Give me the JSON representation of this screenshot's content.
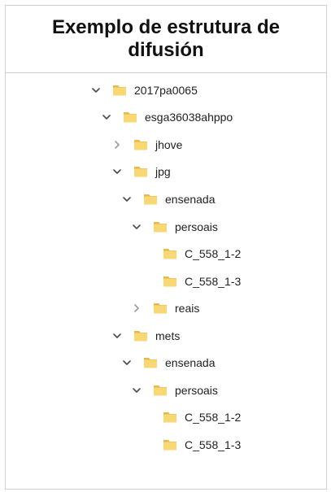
{
  "title": {
    "line1": "Exemplo de estrutura de",
    "line2": "difusión"
  },
  "colors": {
    "folder_fill": "#F8D775",
    "folder_back": "#E8B84A",
    "chevron": "#4a4a4a",
    "chevron_collapsed": "#9a9a9a",
    "border": "#cfcfcf"
  },
  "tree": [
    {
      "label": "2017pa0065",
      "expander": "expanded",
      "icon": "folder-icon"
    },
    {
      "label": "esga36038ahppo",
      "expander": "expanded",
      "icon": "folder-icon"
    },
    {
      "label": "jhove",
      "expander": "collapsed",
      "icon": "folder-icon"
    },
    {
      "label": "jpg",
      "expander": "expanded",
      "icon": "folder-icon"
    },
    {
      "label": "ensenada",
      "expander": "expanded",
      "icon": "folder-icon"
    },
    {
      "label": "persoais",
      "expander": "expanded",
      "icon": "folder-icon"
    },
    {
      "label": "C_558_1-2",
      "expander": "none",
      "icon": "folder-icon"
    },
    {
      "label": "C_558_1-3",
      "expander": "none",
      "icon": "folder-icon"
    },
    {
      "label": "reais",
      "expander": "collapsed",
      "icon": "folder-icon"
    },
    {
      "label": "mets",
      "expander": "expanded",
      "icon": "folder-icon"
    },
    {
      "label": "ensenada",
      "expander": "expanded",
      "icon": "folder-icon"
    },
    {
      "label": "persoais",
      "expander": "expanded",
      "icon": "folder-icon"
    },
    {
      "label": "C_558_1-2",
      "expander": "none",
      "icon": "folder-icon"
    },
    {
      "label": "C_558_1-3",
      "expander": "none",
      "icon": "folder-icon"
    }
  ]
}
